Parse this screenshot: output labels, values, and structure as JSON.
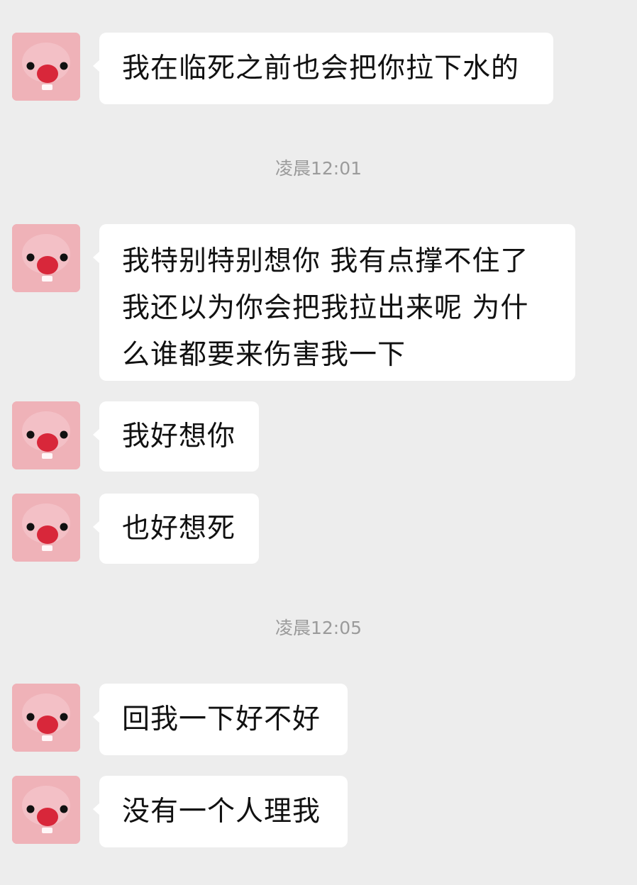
{
  "conversation": {
    "items": [
      {
        "type": "message",
        "sender_avatar": "pink-plush-avatar",
        "text": "我在临死之前也会把你拉下水的"
      },
      {
        "type": "timestamp",
        "text": "凌晨12:01"
      },
      {
        "type": "message",
        "sender_avatar": "pink-plush-avatar",
        "text": "我特别特别想你 我有点撑不住了\n我还以为你会把我拉出来呢 为什\n么谁都要来伤害我一下"
      },
      {
        "type": "message",
        "sender_avatar": "pink-plush-avatar",
        "text": "我好想你"
      },
      {
        "type": "message",
        "sender_avatar": "pink-plush-avatar",
        "text": "也好想死"
      },
      {
        "type": "timestamp",
        "text": "凌晨12:05"
      },
      {
        "type": "message",
        "sender_avatar": "pink-plush-avatar",
        "text": "回我一下好不好"
      },
      {
        "type": "message",
        "sender_avatar": "pink-plush-avatar",
        "text": "没有一个人理我"
      }
    ]
  },
  "colors": {
    "background": "#ededed",
    "bubble": "#ffffff",
    "text": "#111111",
    "timestamp": "#9b9b9b",
    "avatar_pink": "#efb2b8",
    "avatar_nose": "#d8273a"
  }
}
